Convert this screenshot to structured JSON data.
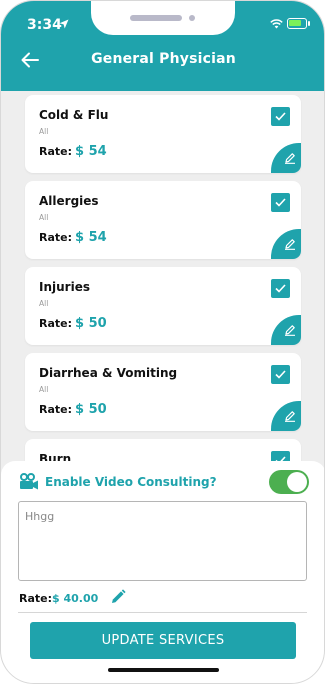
{
  "status_bar": {
    "time": "3:34"
  },
  "header": {
    "title": "General Physician"
  },
  "services": [
    {
      "name": "Cold & Flu",
      "category": "All",
      "rate_label": "Rate:",
      "rate": "$ 54",
      "checked": true
    },
    {
      "name": "Allergies",
      "category": "All",
      "rate_label": "Rate:",
      "rate": "$ 54",
      "checked": true
    },
    {
      "name": "Injuries",
      "category": "All",
      "rate_label": "Rate:",
      "rate": "$ 50",
      "checked": true
    },
    {
      "name": "Diarrhea & Vomiting",
      "category": "All",
      "rate_label": "Rate:",
      "rate": "$ 50",
      "checked": true
    },
    {
      "name": "Burn",
      "category": "",
      "rate_label": "",
      "rate": "",
      "checked": true
    }
  ],
  "video_consulting": {
    "label": "Enable Video Consulting?",
    "enabled": true,
    "notes_value": "Hhgg",
    "rate_label": "Rate:",
    "rate": "$ 40.00"
  },
  "actions": {
    "update_label": "UPDATE SERVICES"
  },
  "colors": {
    "primary": "#1fa3ac",
    "toggle_on": "#4caf50",
    "battery": "#7cf05a"
  },
  "icons": {
    "back": "arrow-left-icon",
    "check": "check-icon",
    "edit": "pencil-icon",
    "video": "video-camera-icon",
    "location": "location-arrow-icon",
    "wifi": "wifi-icon",
    "battery": "battery-icon"
  }
}
